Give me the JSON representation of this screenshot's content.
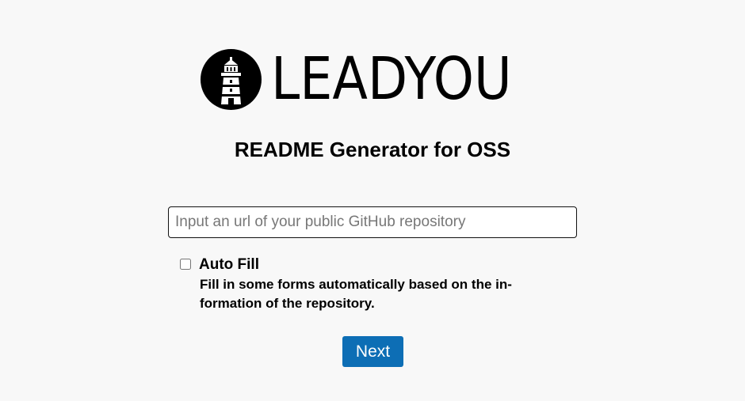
{
  "logo": {
    "text": "LEADYOU",
    "icon": "lighthouse-icon"
  },
  "subtitle": "README Generator for OSS",
  "repo_input": {
    "value": "",
    "placeholder": "Input an url of your public GitHub repository"
  },
  "auto_fill": {
    "label": "Auto Fill",
    "checked": false,
    "description": "Fill in some forms automatically based on the in-formation of the repository."
  },
  "next_button": {
    "label": "Next"
  },
  "colors": {
    "background": "#f8f8f8",
    "accent": "#0d6eb5",
    "text": "#000000"
  }
}
